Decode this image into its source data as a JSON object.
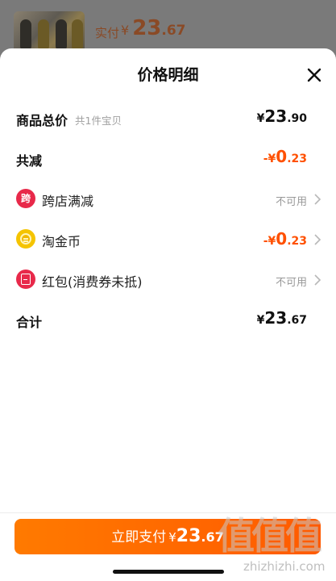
{
  "background": {
    "paid_label": "实付",
    "currency": "¥",
    "price_int": "23",
    "price_dec": ".67"
  },
  "sheet": {
    "title": "价格明细",
    "close_icon": "close-icon",
    "rows": {
      "total": {
        "label": "商品总价",
        "sub": "共1件宝贝",
        "currency": "¥",
        "int": "23",
        "dec": ".90"
      },
      "reduction": {
        "label": "共减",
        "currency": "-¥",
        "int": "0",
        "dec": ".23"
      },
      "cross_store": {
        "icon_text": "跨",
        "label": "跨店满减",
        "status": "不可用"
      },
      "taojinbi": {
        "label": "淘金币",
        "currency": "-¥",
        "int": "0",
        "dec": ".23"
      },
      "hongbao": {
        "label": "红包(消费券未抵)",
        "status": "不可用"
      },
      "sum": {
        "label": "合计",
        "currency": "¥",
        "int": "23",
        "dec": ".67"
      }
    }
  },
  "footer": {
    "pay_label": "立即支付",
    "currency": "¥",
    "amount_int": "23",
    "amount_dec": ".67"
  },
  "watermark": {
    "logo": "值值值",
    "site": "zhizhizhi.com"
  },
  "colors": {
    "accent_orange": "#ff5000",
    "badge_red": "#e8294a",
    "coin_yellow": "#f5c400"
  }
}
